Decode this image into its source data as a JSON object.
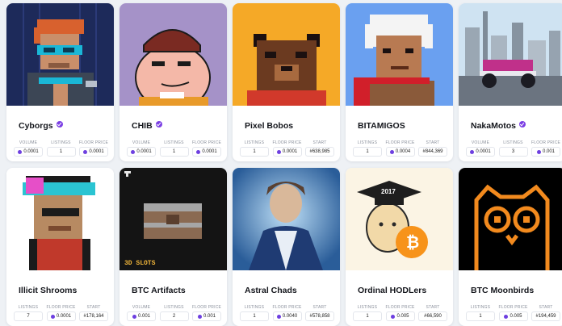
{
  "row1": [
    {
      "name": "Cyborgs",
      "verified": true,
      "stats": [
        {
          "label": "VOLUME",
          "value": "0.0001",
          "coin": true
        },
        {
          "label": "LISTINGS",
          "value": "1"
        },
        {
          "label": "FLOOR PRICE",
          "value": "0.0001",
          "coin": true
        }
      ]
    },
    {
      "name": "CHIB",
      "verified": true,
      "stats": [
        {
          "label": "VOLUME",
          "value": "0.0001",
          "coin": true
        },
        {
          "label": "LISTINGS",
          "value": "1"
        },
        {
          "label": "FLOOR PRICE",
          "value": "0.0001",
          "coin": true
        }
      ]
    },
    {
      "name": "Pixel Bobos",
      "verified": false,
      "stats": [
        {
          "label": "LISTINGS",
          "value": "1"
        },
        {
          "label": "FLOOR PRICE",
          "value": "0.0001",
          "coin": true
        },
        {
          "label": "START",
          "value": "#638,985"
        }
      ]
    },
    {
      "name": "BITAMIGOS",
      "verified": false,
      "stats": [
        {
          "label": "LISTINGS",
          "value": "1"
        },
        {
          "label": "FLOOR PRICE",
          "value": "0.0004",
          "coin": true
        },
        {
          "label": "START",
          "value": "#844,369"
        }
      ]
    },
    {
      "name": "NakaMotos",
      "verified": true,
      "stats": [
        {
          "label": "VOLUME",
          "value": "0.0001",
          "coin": true
        },
        {
          "label": "LISTINGS",
          "value": "3"
        },
        {
          "label": "FLOOR PRICE",
          "value": "0.001",
          "coin": true
        }
      ]
    }
  ],
  "row2": [
    {
      "name": "Illicit Shrooms",
      "verified": false,
      "stats": [
        {
          "label": "LISTINGS",
          "value": "7"
        },
        {
          "label": "FLOOR PRICE",
          "value": "0.0001",
          "coin": true
        },
        {
          "label": "START",
          "value": "#178,164"
        }
      ]
    },
    {
      "name": "BTC Artifacts",
      "verified": false,
      "image_caption": "3D SLOTS",
      "stats": [
        {
          "label": "VOLUME",
          "value": "0.001",
          "coin": true
        },
        {
          "label": "LISTINGS",
          "value": "2"
        },
        {
          "label": "FLOOR PRICE",
          "value": "0.001",
          "coin": true
        }
      ]
    },
    {
      "name": "Astral Chads",
      "verified": false,
      "stats": [
        {
          "label": "LISTINGS",
          "value": "1"
        },
        {
          "label": "FLOOR PRICE",
          "value": "0.0040",
          "coin": true
        },
        {
          "label": "START",
          "value": "#578,858"
        }
      ]
    },
    {
      "name": "Ordinal HODLers",
      "verified": false,
      "image_caption": "2017",
      "stats": [
        {
          "label": "LISTINGS",
          "value": "1"
        },
        {
          "label": "FLOOR PRICE",
          "value": "0.005",
          "coin": true
        },
        {
          "label": "START",
          "value": "#66,590"
        }
      ]
    },
    {
      "name": "BTC Moonbirds",
      "verified": false,
      "stats": [
        {
          "label": "LISTINGS",
          "value": "1"
        },
        {
          "label": "FLOOR PRICE",
          "value": "0.005",
          "coin": true
        },
        {
          "label": "START",
          "value": "#194,459"
        }
      ]
    }
  ],
  "colors": {
    "accent": "#7b3fe4",
    "coin": "#6d3fe0"
  }
}
